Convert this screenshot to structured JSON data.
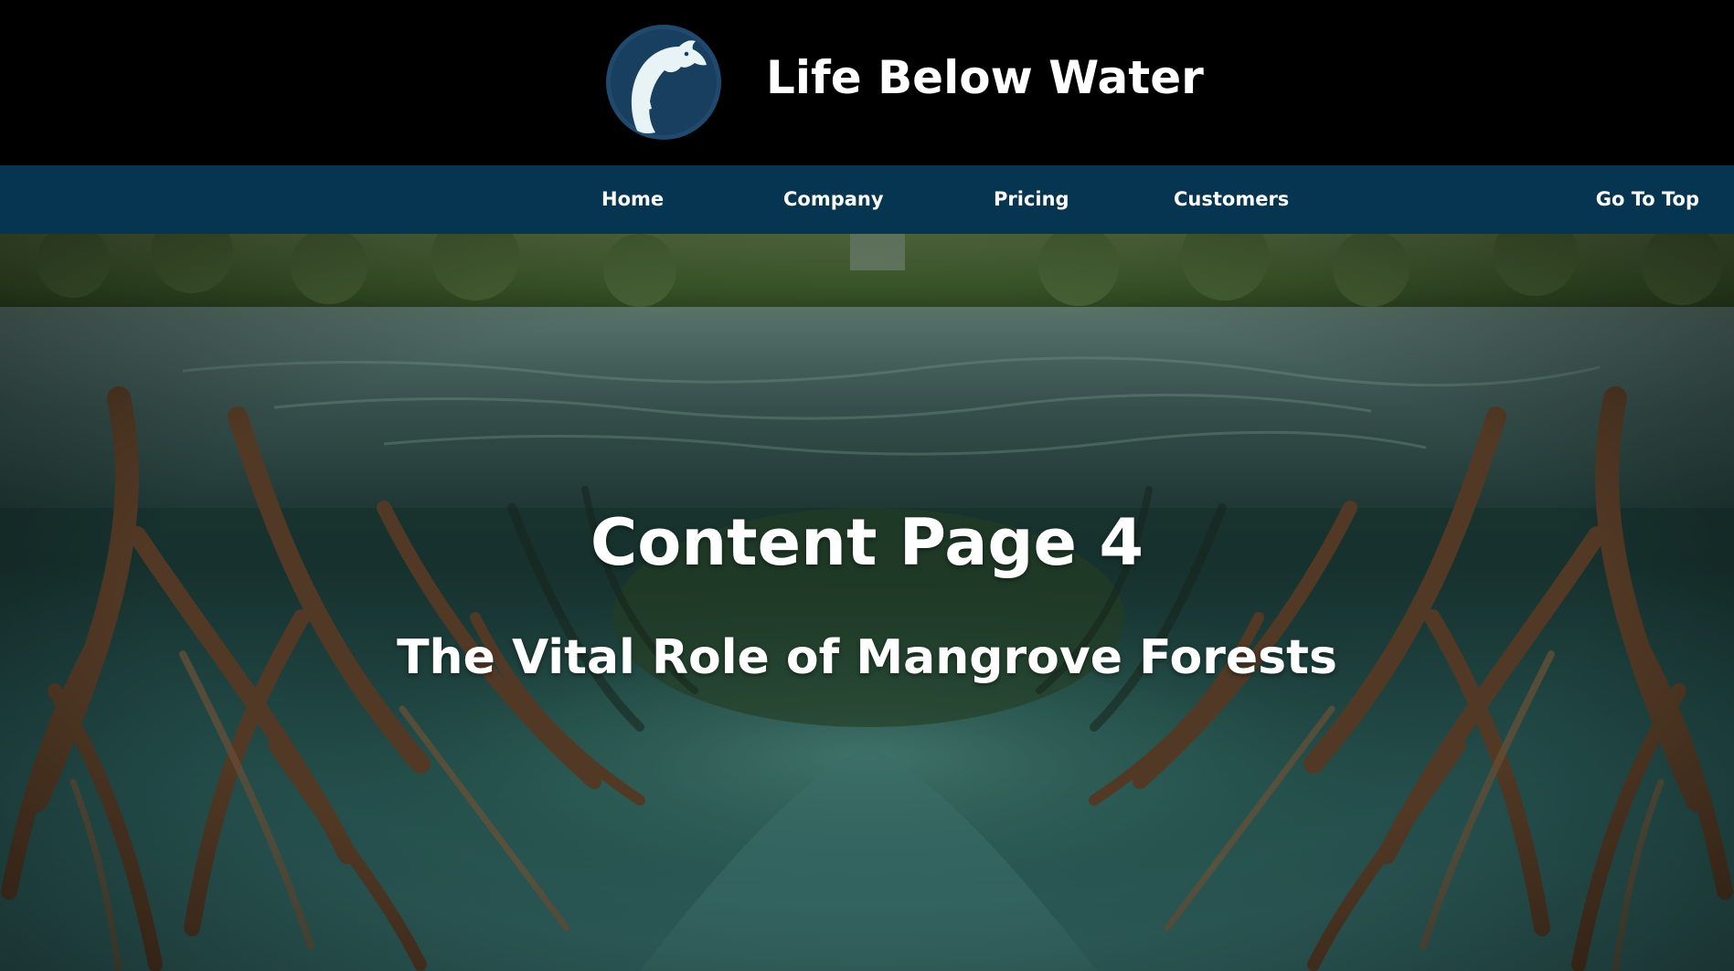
{
  "header": {
    "site_title": "Life Below Water",
    "logo_icon": "dolphin-icon",
    "background_color": "#000000"
  },
  "nav": {
    "background_color": "#053550",
    "items": [
      {
        "label": "Home"
      },
      {
        "label": "Company"
      },
      {
        "label": "Pricing"
      },
      {
        "label": "Customers"
      }
    ],
    "go_to_top": "Go To Top"
  },
  "hero": {
    "heading": "Content Page 4",
    "subheading": "The Vital Role of Mangrove Forests",
    "background_image": "mangrove-forest-underwater-roots"
  }
}
